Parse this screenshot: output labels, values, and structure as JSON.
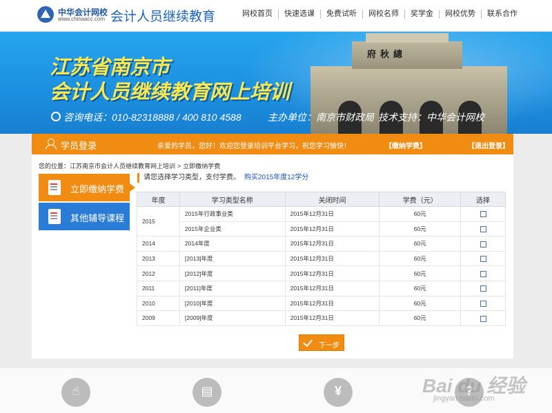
{
  "header": {
    "logo_cn": "中华会计网校",
    "logo_url": "www.chinaacc.com",
    "site_title": "会计人员继续教育",
    "nav": [
      "网校首页",
      "快速选课",
      "免费试听",
      "网校名师",
      "奖学金",
      "网校优势",
      "联系合作"
    ]
  },
  "banner": {
    "title_line1": "江苏省南京市",
    "title_line2": "会计人员继续教育网上培训",
    "phone": "咨询电话：010-82318888 / 400 810 4588",
    "host": "主办单位：南京市财政局",
    "support": "技术支持：中华会计网校",
    "building_sign": "府秋總"
  },
  "bar": {
    "title": "学员登录",
    "welcome": "亲爱的学员，您好！欢迎您登录培训平台学习，祝您学习愉快！",
    "pay": "【缴纳学费】",
    "logout": "【退出登录】"
  },
  "breadcrumb": {
    "prefix": "您的位置：",
    "crumb1": "江苏南京市会计人员继续教育网上培训",
    "sep": ">",
    "crumb2": "立即缴纳学费"
  },
  "sidebar": {
    "pay_label": "立即缴纳学费",
    "other_label": "其他辅导课程"
  },
  "hint": {
    "text": "请您选择学习类型，支付学费。",
    "link": "购买2015年度12学分"
  },
  "table": {
    "headers": [
      "年度",
      "学习类型名称",
      "关闭时间",
      "学费（元）",
      "选择"
    ],
    "year_2015": "2015",
    "rows": [
      {
        "year": "",
        "name": "2015年行政事业类",
        "close": "2015年12月31日",
        "fee": "60元"
      },
      {
        "year": "",
        "name": "2015年企业类",
        "close": "2015年12月31日",
        "fee": "60元"
      },
      {
        "year": "2014",
        "name": "2014年度",
        "close": "2015年12月31日",
        "fee": "60元"
      },
      {
        "year": "2013",
        "name": "[2013]年度",
        "close": "2015年12月31日",
        "fee": "60元"
      },
      {
        "year": "2012",
        "name": "[2012]年度",
        "close": "2015年12月31日",
        "fee": "60元"
      },
      {
        "year": "2011",
        "name": "[2011]年度",
        "close": "2015年12月31日",
        "fee": "60元"
      },
      {
        "year": "2010",
        "name": "[2010]年度",
        "close": "2015年12月31日",
        "fee": "60元"
      },
      {
        "year": "2009",
        "name": "[2009]年度",
        "close": "2015年12月31日",
        "fee": "60元"
      }
    ]
  },
  "next_button": "下一步",
  "footer": {
    "icons": [
      "hand-icon",
      "clipboard-icon",
      "yen-icon",
      "question-icon"
    ],
    "yen_glyph": "¥",
    "question_glyph": "?"
  },
  "watermark": {
    "main": "Bai du 经验",
    "sub": "jingyan.baidu.com"
  }
}
